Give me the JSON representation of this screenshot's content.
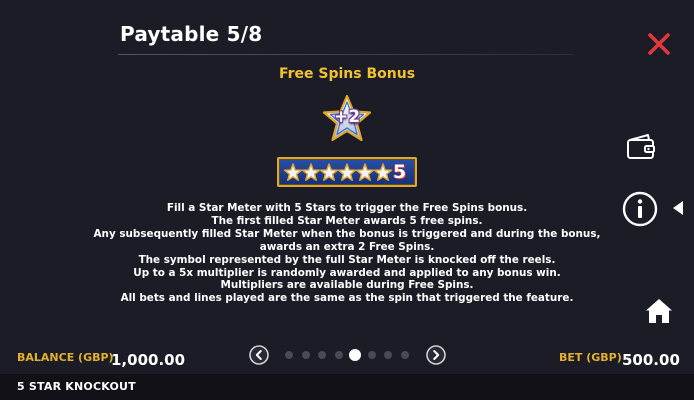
{
  "header": {
    "title": "Paytable 5/8"
  },
  "section": {
    "title": "Free Spins Bonus",
    "badge_text": "+2",
    "meter_number": "5",
    "meter_star_count": 6
  },
  "description": {
    "lines": [
      "Fill a Star Meter with 5 Stars to trigger the Free Spins bonus.",
      "The first filled Star Meter awards 5 free spins.",
      "Any subsequently filled Star Meter when the bonus is triggered and during the bonus,",
      "awards an extra 2 Free Spins.",
      "The symbol represented by the full Star Meter is knocked off the reels.",
      "Up to a 5x multiplier is randomly awarded and applied to any bonus win.",
      "Multipliers are available during Free Spins.",
      "All bets and lines played are the same as the spin that triggered the feature."
    ]
  },
  "balance": {
    "label": "BALANCE (GBP)",
    "value": "1,000.00"
  },
  "bet": {
    "label": "BET (GBP)",
    "value": "500.00"
  },
  "pagination": {
    "total_pages": 8,
    "current_page": 5
  },
  "sidebar": {
    "icons": [
      "wallet-icon",
      "info-icon",
      "arrow-left-icon",
      "home-icon"
    ]
  },
  "footer": {
    "game_name": "5 STAR KNOCKOUT"
  },
  "colors": {
    "background": "#1c1c26",
    "accent_gold": "#f1c232",
    "close_red": "#e5383b",
    "footer_bg": "#111117"
  }
}
